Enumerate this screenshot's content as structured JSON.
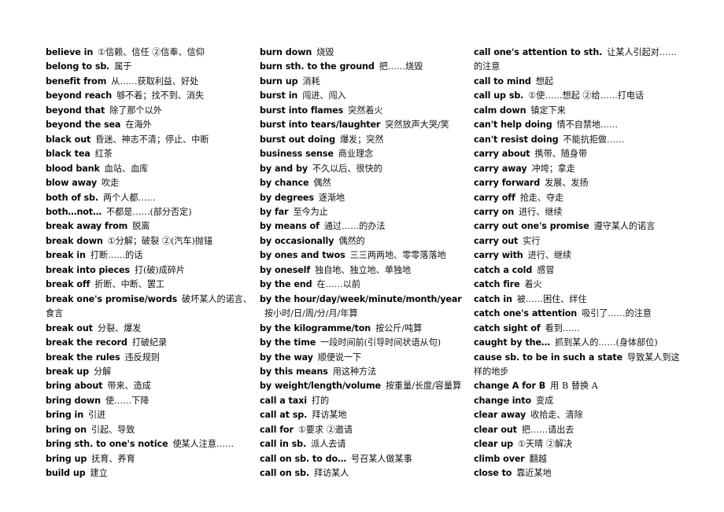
{
  "document": {
    "type": "vocabulary-phrase-list",
    "page_background": "#ffffff",
    "text_color": "#111111",
    "columns": [
      {
        "id": "column-1",
        "entries": [
          {
            "en": "believe in",
            "cn": "①信赖、信任  ②信奉、信仰"
          },
          {
            "en": "belong to sb.",
            "cn": "属于"
          },
          {
            "en": "benefit from",
            "cn": "从……获取利益、好处"
          },
          {
            "en": "beyond reach",
            "cn": "够不着；找不到、消失"
          },
          {
            "en": "beyond that",
            "cn": "除了那个以外"
          },
          {
            "en": "beyond the sea",
            "cn": "在海外"
          },
          {
            "en": "black out",
            "cn": "昏迷、神志不清；停止、中断"
          },
          {
            "en": "black tea",
            "cn": "红茶"
          },
          {
            "en": "blood bank",
            "cn": "血站、血库"
          },
          {
            "en": "blow away",
            "cn": "吹走"
          },
          {
            "en": "both of sb.",
            "cn": "两个人都……"
          },
          {
            "en": "both…not…",
            "cn": "不都是……(部分否定)"
          },
          {
            "en": "break away from",
            "cn": "脱离"
          },
          {
            "en": "break down",
            "cn": "①分解；破裂  ②(汽车)抛锚"
          },
          {
            "en": "break in",
            "cn": "打断……的话"
          },
          {
            "en": "break into pieces",
            "cn": "打(破)成碎片"
          },
          {
            "en": "break off",
            "cn": "折断、中断、罢工"
          },
          {
            "en": "break one's promise/words",
            "cn": "破坏某人的诺言、食言"
          },
          {
            "en": "break out",
            "cn": "分裂、爆发"
          },
          {
            "en": "break the record",
            "cn": "打破纪录"
          },
          {
            "en": "break the rules",
            "cn": "违反规则"
          },
          {
            "en": "break up",
            "cn": "分解"
          },
          {
            "en": "bring about",
            "cn": "带来、造成"
          },
          {
            "en": "bring down",
            "cn": "使……下降"
          },
          {
            "en": "bring in",
            "cn": "引进"
          },
          {
            "en": "bring on",
            "cn": "引起、导致"
          },
          {
            "en": "bring sth. to one's notice",
            "cn": "使某人注意……"
          },
          {
            "en": "bring up",
            "cn": "抚育、养育"
          },
          {
            "en": "build up",
            "cn": "建立"
          }
        ]
      },
      {
        "id": "column-2",
        "entries": [
          {
            "en": "burn down",
            "cn": "烧毁"
          },
          {
            "en": "burn sth. to the ground",
            "cn": "把……烧毁"
          },
          {
            "en": "burn up",
            "cn": "消耗"
          },
          {
            "en": "burst in",
            "cn": "闯进、闯入"
          },
          {
            "en": "burst into flames",
            "cn": "突然着火"
          },
          {
            "en": "burst into tears/laughter",
            "cn": "突然放声大哭/笑"
          },
          {
            "en": "burst out doing",
            "cn": "爆发；突然"
          },
          {
            "en": "business sense",
            "cn": "商业理念"
          },
          {
            "en": "by and by",
            "cn": "不久以后、很快的"
          },
          {
            "en": "by chance",
            "cn": "偶然"
          },
          {
            "en": "by degrees",
            "cn": "逐渐地"
          },
          {
            "en": "by far",
            "cn": "至今为止"
          },
          {
            "en": "by means of",
            "cn": "通过……的办法"
          },
          {
            "en": "by occasionally",
            "cn": "偶然的"
          },
          {
            "en": "by ones and twos",
            "cn": "三三两两地、零零落落地"
          },
          {
            "en": "by oneself",
            "cn": "独自地、独立地、单独地"
          },
          {
            "en": "by the end",
            "cn": "在……以前"
          },
          {
            "en": "by the hour/day/week/minute/month/year",
            "cn": "按小时/日/周/分/月/年算"
          },
          {
            "en": "by the kilogramme/ton",
            "cn": "按公斤/吨算"
          },
          {
            "en": "by the time",
            "cn": "一段时间前(引导时间状语从句)"
          },
          {
            "en": "by the way",
            "cn": "顺便说一下"
          },
          {
            "en": "by this means",
            "cn": "用这种方法"
          },
          {
            "en": "by weight/length/volume",
            "cn": "按重量/长度/容量算"
          },
          {
            "en": "call a taxi",
            "cn": "打的"
          },
          {
            "en": "call at sp.",
            "cn": "拜访某地"
          },
          {
            "en": "call for",
            "cn": "①要求  ②邀请"
          },
          {
            "en": "call in sb.",
            "cn": "派人去请"
          },
          {
            "en": "call on sb. to do…",
            "cn": "号召某人做某事"
          },
          {
            "en": "call on sb.",
            "cn": "拜访某人"
          }
        ]
      },
      {
        "id": "column-3",
        "entries": [
          {
            "en": "call one's attention to sth.",
            "cn": "让某人引起对……的注意"
          },
          {
            "en": "call to mind",
            "cn": "想起"
          },
          {
            "en": "call up sb.",
            "cn": "①使……想起  ②给……打电话"
          },
          {
            "en": "calm down",
            "cn": "镇定下来"
          },
          {
            "en": "can't help doing",
            "cn": "情不自禁地……"
          },
          {
            "en": "can't resist doing",
            "cn": "不能抗拒做……"
          },
          {
            "en": "carry about",
            "cn": "携带、随身带"
          },
          {
            "en": "carry away",
            "cn": "冲垮；拿走"
          },
          {
            "en": "carry forward",
            "cn": "发展、发扬"
          },
          {
            "en": "carry off",
            "cn": "抢走、夺走"
          },
          {
            "en": "carry on",
            "cn": "进行、继续"
          },
          {
            "en": "carry out one's promise",
            "cn": "遵守某人的诺言"
          },
          {
            "en": "carry out",
            "cn": "实行"
          },
          {
            "en": "carry with",
            "cn": "进行、继续"
          },
          {
            "en": "catch a cold",
            "cn": "感冒"
          },
          {
            "en": "catch fire",
            "cn": "着火"
          },
          {
            "en": "catch in",
            "cn": "被……困住、绊住"
          },
          {
            "en": "catch one's attention",
            "cn": "吸引了……的注意"
          },
          {
            "en": "catch sight of",
            "cn": "看到……"
          },
          {
            "en": "caught by the…",
            "cn": "抓到某人的……(身体部位)"
          },
          {
            "en": "cause sb. to be in such a state",
            "cn": "导致某人到这样的地步"
          },
          {
            "en": "change A for B",
            "cn": "用 B 替换 A"
          },
          {
            "en": "change into",
            "cn": "变成"
          },
          {
            "en": "clear away",
            "cn": "收拾走、清除"
          },
          {
            "en": "clear out",
            "cn": "把……请出去"
          },
          {
            "en": "clear up",
            "cn": "①天晴  ②解决"
          },
          {
            "en": "climb over",
            "cn": "翻越"
          },
          {
            "en": "close to",
            "cn": "靠近某地"
          }
        ]
      }
    ]
  }
}
